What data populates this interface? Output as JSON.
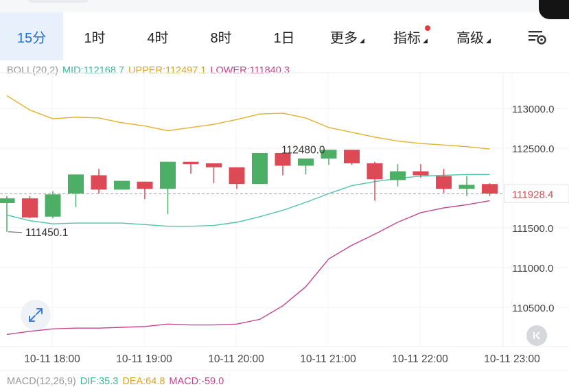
{
  "tabs": [
    {
      "label": "15分",
      "active": true
    },
    {
      "label": "1时"
    },
    {
      "label": "4时"
    },
    {
      "label": "8时"
    },
    {
      "label": "1日"
    },
    {
      "label": "更多",
      "dropdown": true
    },
    {
      "label": "指标",
      "dropdown": true,
      "badge": true
    },
    {
      "label": "高级",
      "dropdown": true
    }
  ],
  "legend": {
    "name": "BOLL(20,2)",
    "mid": "MID:112168.7",
    "upper": "UPPER:112497.1",
    "lower": "LOWER:111840.3"
  },
  "colors": {
    "up": "#4caf65",
    "down": "#dc4b55",
    "mid": "#4cc4a8",
    "upper": "#e3b12a",
    "lower": "#c4448f",
    "accent": "#1e6fd9",
    "badge": "#e23b3b"
  },
  "chart_data": {
    "type": "candlestick",
    "ylim": [
      110200,
      113500
    ],
    "y_ticks": [
      "113000.0",
      "112500.0",
      "112000.0",
      "111500.0",
      "111000.0",
      "110500.0"
    ],
    "x_ticks": [
      "10-11 18:00",
      "10-11 19:00",
      "10-11 20:00",
      "10-11 21:00",
      "10-11 22:00",
      "10-11 23:00"
    ],
    "current_price": "111928.4",
    "high_label": "112480.0",
    "low_label": "111450.1",
    "candles": [
      {
        "o": 111810,
        "h": 111900,
        "l": 111450,
        "c": 111870
      },
      {
        "o": 111870,
        "h": 111900,
        "l": 111620,
        "c": 111630
      },
      {
        "o": 111640,
        "h": 111960,
        "l": 111620,
        "c": 111920
      },
      {
        "o": 111930,
        "h": 112170,
        "l": 111760,
        "c": 112170
      },
      {
        "o": 112160,
        "h": 112240,
        "l": 111930,
        "c": 111980
      },
      {
        "o": 111980,
        "h": 112090,
        "l": 111980,
        "c": 112090
      },
      {
        "o": 112080,
        "h": 112080,
        "l": 111860,
        "c": 111990
      },
      {
        "o": 111990,
        "h": 112330,
        "l": 111670,
        "c": 112330
      },
      {
        "o": 112330,
        "h": 112330,
        "l": 112180,
        "c": 112300
      },
      {
        "o": 112310,
        "h": 112310,
        "l": 112060,
        "c": 112260
      },
      {
        "o": 112260,
        "h": 112260,
        "l": 111990,
        "c": 112050
      },
      {
        "o": 112050,
        "h": 112440,
        "l": 112050,
        "c": 112440
      },
      {
        "o": 112440,
        "h": 112440,
        "l": 112160,
        "c": 112280
      },
      {
        "o": 112280,
        "h": 112370,
        "l": 112170,
        "c": 112370
      },
      {
        "o": 112370,
        "h": 112480,
        "l": 112290,
        "c": 112480
      },
      {
        "o": 112480,
        "h": 112480,
        "l": 112290,
        "c": 112310
      },
      {
        "o": 112310,
        "h": 112330,
        "l": 111840,
        "c": 112110
      },
      {
        "o": 112100,
        "h": 112300,
        "l": 112020,
        "c": 112210
      },
      {
        "o": 112210,
        "h": 112300,
        "l": 112130,
        "c": 112160
      },
      {
        "o": 112150,
        "h": 112240,
        "l": 111940,
        "c": 111990
      },
      {
        "o": 111990,
        "h": 112150,
        "l": 111900,
        "c": 112040
      },
      {
        "o": 112050,
        "h": 112060,
        "l": 111900,
        "c": 111930
      }
    ],
    "upper": [
      113160,
      112980,
      112870,
      112890,
      112880,
      112820,
      112780,
      112720,
      112760,
      112800,
      112860,
      112930,
      112940,
      112880,
      112760,
      112700,
      112640,
      112590,
      112560,
      112540,
      112520,
      112490
    ],
    "mid": [
      111660,
      111590,
      111550,
      111560,
      111560,
      111560,
      111540,
      111520,
      111520,
      111530,
      111570,
      111640,
      111720,
      111820,
      111930,
      112030,
      112080,
      112120,
      112150,
      112160,
      112170,
      112170
    ],
    "lower": [
      110160,
      110200,
      110230,
      110240,
      110240,
      110250,
      110260,
      110290,
      110280,
      110280,
      110290,
      110350,
      110520,
      110760,
      111110,
      111280,
      111420,
      111570,
      111690,
      111750,
      111790,
      111840
    ]
  },
  "macd": {
    "name": "MACD(12,26,9)",
    "dif": "DIF:35.3",
    "dea": "DEA:64.8",
    "macd": "MACD:-59.0"
  }
}
